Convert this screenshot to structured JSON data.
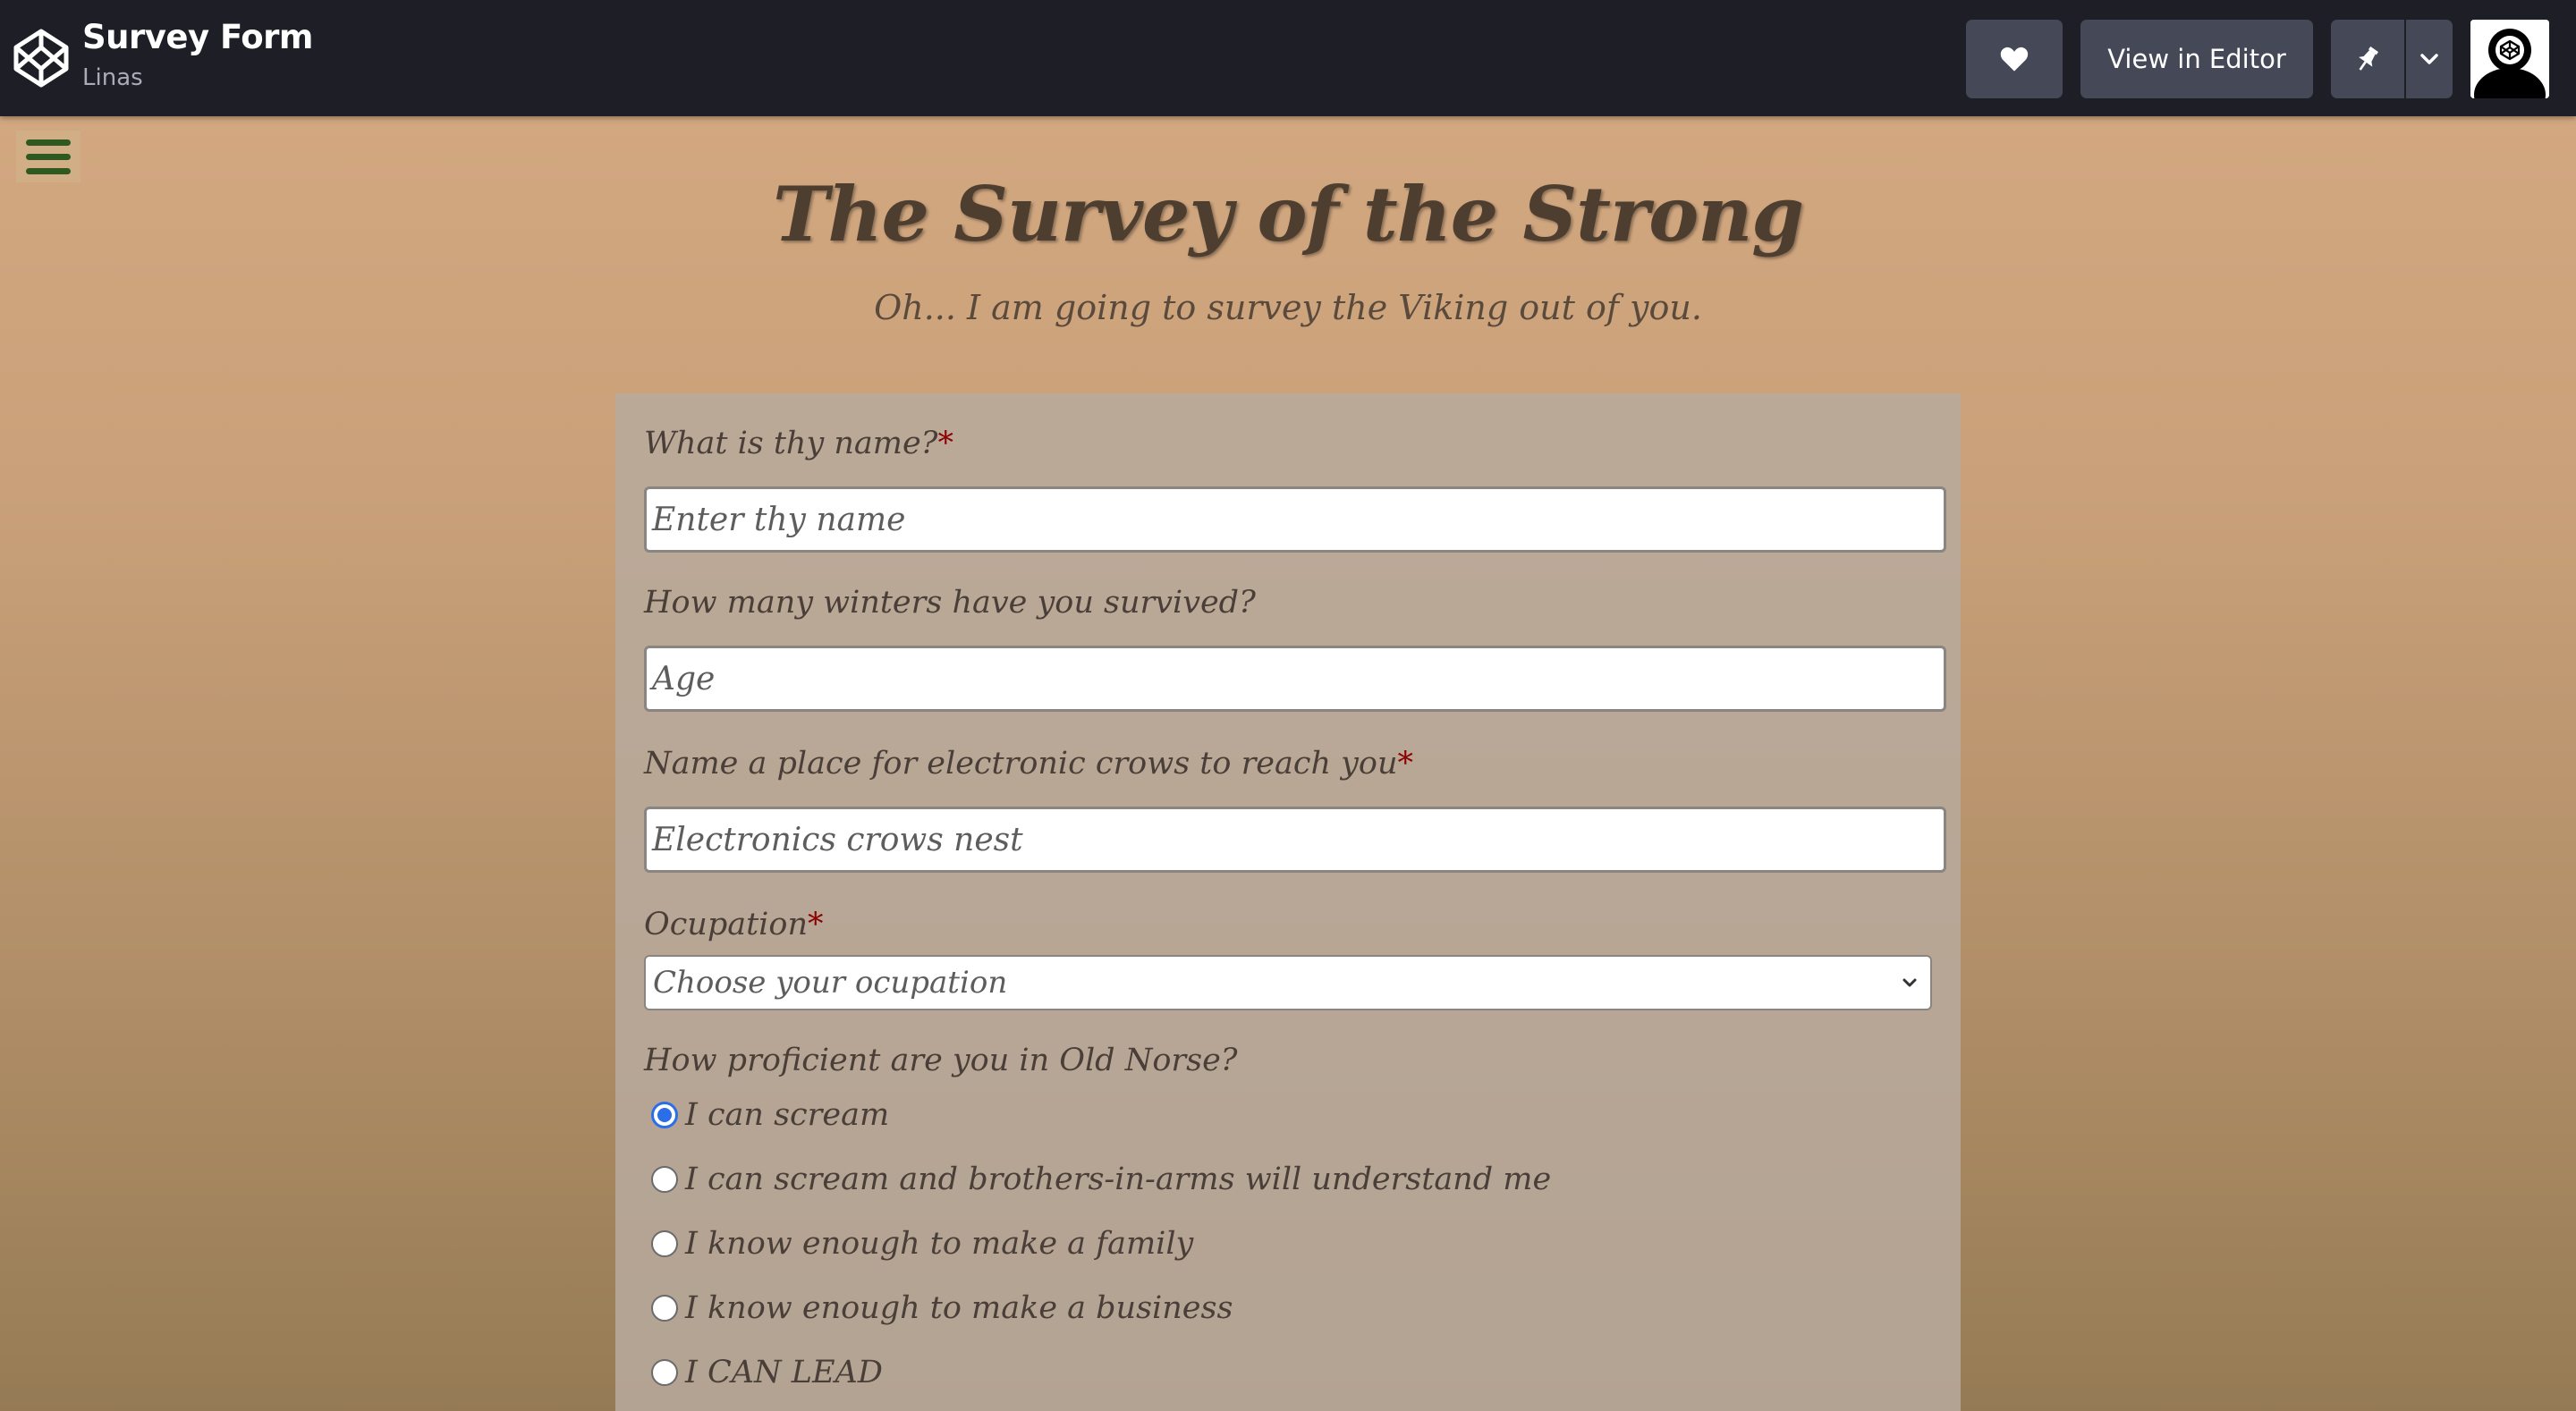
{
  "topbar": {
    "pen_title": "Survey Form",
    "pen_author": "Linas",
    "heart_icon": "heart-icon",
    "view_in_editor_label": "View in Editor",
    "pin_icon": "pin-icon",
    "chevron_icon": "chevron-down-icon",
    "logo_icon": "codepen-logo-icon",
    "avatar_icon": "user-avatar-icon"
  },
  "menu": {
    "icon": "hamburger-menu-icon"
  },
  "header": {
    "title": "The Survey of the Strong",
    "subtitle": "Oh... I am going to survey the Viking out of you."
  },
  "form": {
    "name": {
      "label": "What is thy name?",
      "required_mark": "*",
      "placeholder": "Enter thy name"
    },
    "age": {
      "label": "How many winters have you survived?",
      "placeholder": "Age"
    },
    "email": {
      "label": "Name a place for electronic crows to reach you",
      "required_mark": "*",
      "placeholder": "Electronics crows nest"
    },
    "occupation": {
      "label": "Ocupation",
      "required_mark": "*",
      "selected": "Choose your ocupation"
    },
    "proficiency": {
      "label": "How proficient are you in Old Norse?",
      "options": [
        {
          "label": "I can scream",
          "checked": true
        },
        {
          "label": "I can scream and brothers-in-arms will understand me",
          "checked": false
        },
        {
          "label": "I know enough to make a family",
          "checked": false
        },
        {
          "label": "I know enough to make a business",
          "checked": false
        },
        {
          "label": "I CAN LEAD",
          "checked": false
        }
      ]
    }
  },
  "colors": {
    "topbar_bg": "#1e1f26",
    "button_bg": "#444857",
    "required": "#8b0000",
    "radio_accent": "#2a6ee8",
    "hamburger": "#2f5a1f"
  }
}
